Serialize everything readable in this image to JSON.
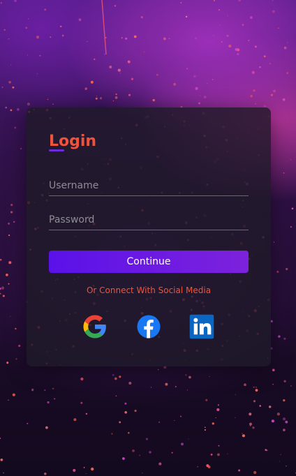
{
  "login": {
    "title": "Login",
    "username_placeholder": "Username",
    "password_placeholder": "Password",
    "continue_label": "Continue",
    "social_label": "Or Connect With Social Media",
    "social_icons": [
      "google-icon",
      "facebook-icon",
      "linkedin-icon"
    ]
  },
  "colors": {
    "accent": "#f0533a",
    "button_start": "#5a12e8",
    "button_end": "#7d22dc",
    "underline": "#6a2cd8",
    "facebook": "#1877f2",
    "linkedin": "#0a66c2"
  }
}
